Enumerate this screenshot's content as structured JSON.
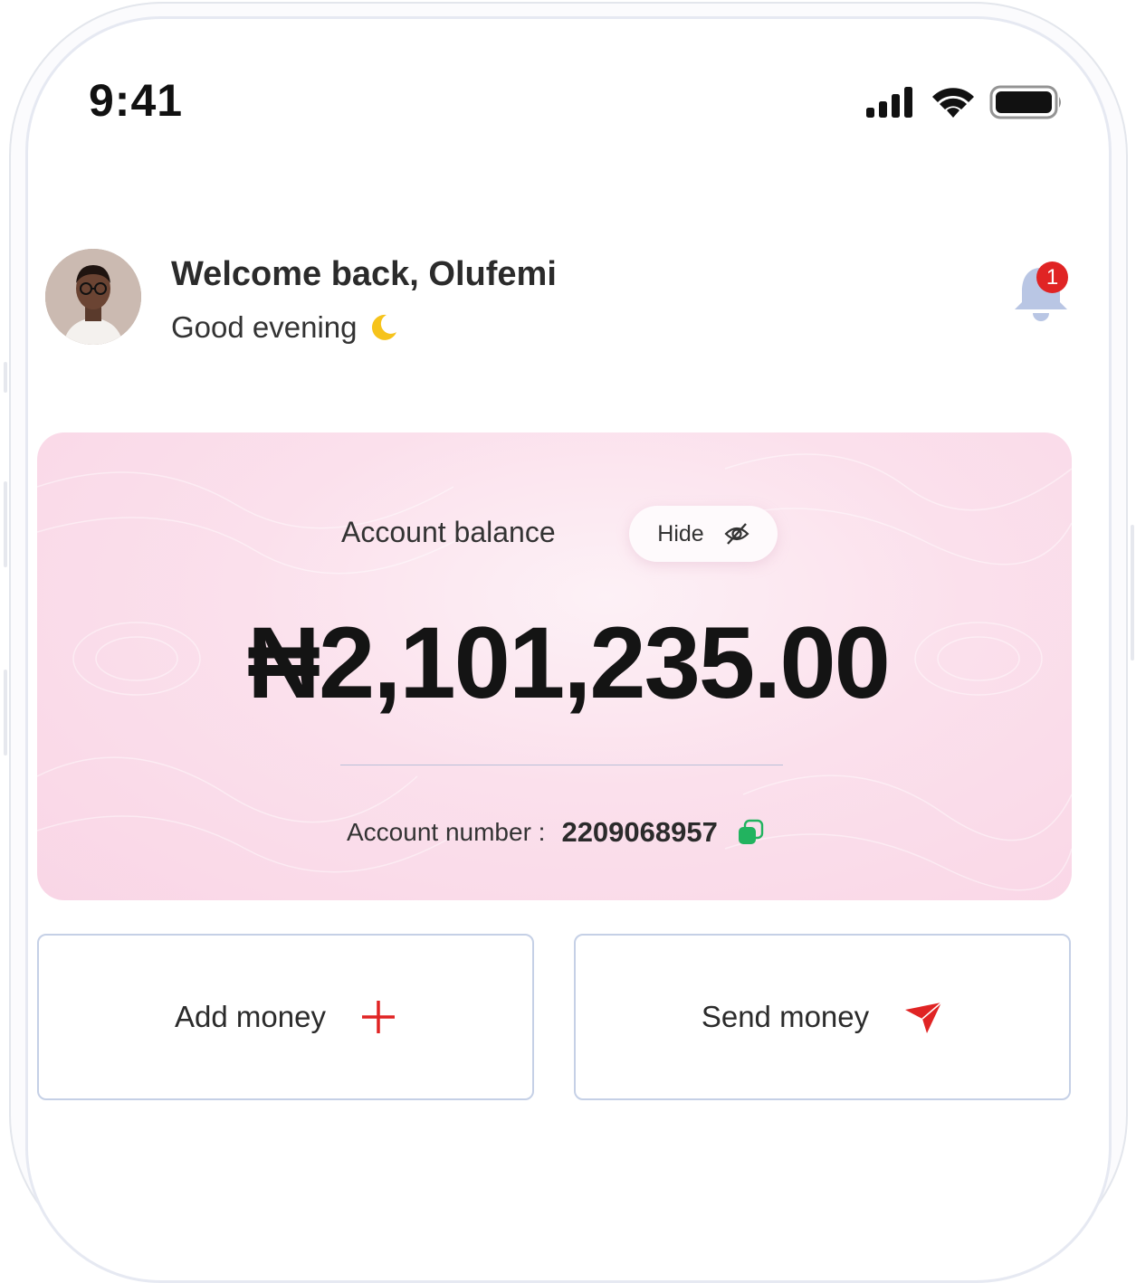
{
  "status_bar": {
    "time": "9:41"
  },
  "header": {
    "welcome": "Welcome back, Olufemi",
    "greeting": "Good evening",
    "notification_count": "1"
  },
  "balance_card": {
    "label": "Account balance",
    "hide_label": "Hide",
    "amount": "₦2,101,235.00",
    "account_number_label": "Account number :",
    "account_number": "2209068957"
  },
  "actions": {
    "add_money": "Add money",
    "send_money": "Send money"
  },
  "colors": {
    "accent_red": "#e02424",
    "moon_yellow": "#f6c31b",
    "copy_green": "#22b35f",
    "bell_blue": "#b9c6e4",
    "card_pink": "#f9d6e6"
  },
  "icons": {
    "signal": "signal-icon",
    "wifi": "wifi-icon",
    "battery": "battery-icon",
    "moon": "moon-icon",
    "bell": "bell-icon",
    "eye_off": "eye-off-icon",
    "copy": "copy-icon",
    "plus": "plus-icon",
    "send": "send-icon"
  }
}
